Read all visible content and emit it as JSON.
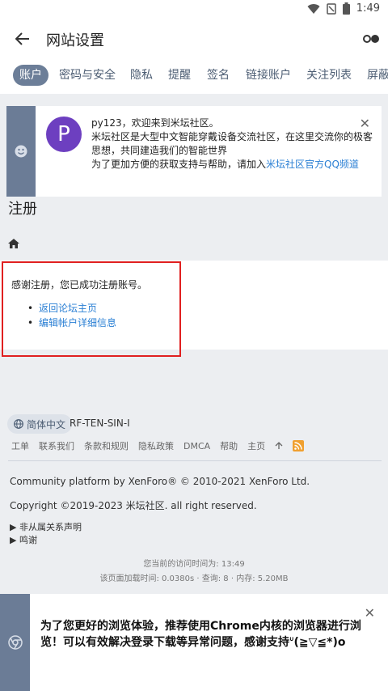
{
  "status": {
    "time": "1:49"
  },
  "appbar": {
    "title": "网站设置"
  },
  "tabs": [
    "账户",
    "密码与安全",
    "隐私",
    "提醒",
    "签名",
    "链接账户",
    "关注列表",
    "屏蔽"
  ],
  "notice": {
    "avatar_letter": "P",
    "line1": "py123，欢迎来到米坛社区。",
    "line2": "米坛社区是大型中文智能穿戴设备交流社区，在这里交流你的极客思想，共同建造我们的智能世界",
    "line3_prefix": "为了更加方便的获取支持与帮助，请加入",
    "line3_link": "米坛社区官方QQ频道"
  },
  "page": {
    "title": "注册",
    "success_message": "感谢注册，您已成功注册账号。",
    "links": [
      "返回论坛主页",
      "编辑帐户详细信息"
    ]
  },
  "footer": {
    "language": "简体中文",
    "style": "RF-TEN-SIN-I",
    "links": [
      "工单",
      "联系我们",
      "条款和规则",
      "隐私政策",
      "DMCA",
      "帮助",
      "主页"
    ],
    "copyright1": "Community platform by XenForo® © 2010-2021 XenForo Ltd.",
    "copyright2": "Copyright ©2019-2023 米坛社区. all right reserved.",
    "disclosure1": "▶ 非从属关系声明",
    "disclosure2": "▶ 鸣谢",
    "stats1": "您当前的访问时间为: 13:49",
    "stats2": "该页面加载时间: 0.0380s · 查询: 8 · 内存: 5.20MB"
  },
  "banner": {
    "text": "为了您更好的浏览体验，推荐使用Chrome内核的浏览器进行浏览！可以有效解决登录下载等异常问题，感谢支持ᐡ(≧▽≦*)o"
  },
  "colors": {
    "accent": "#6b7c96",
    "link": "#2a7fd4",
    "highlight": "#e02020"
  }
}
